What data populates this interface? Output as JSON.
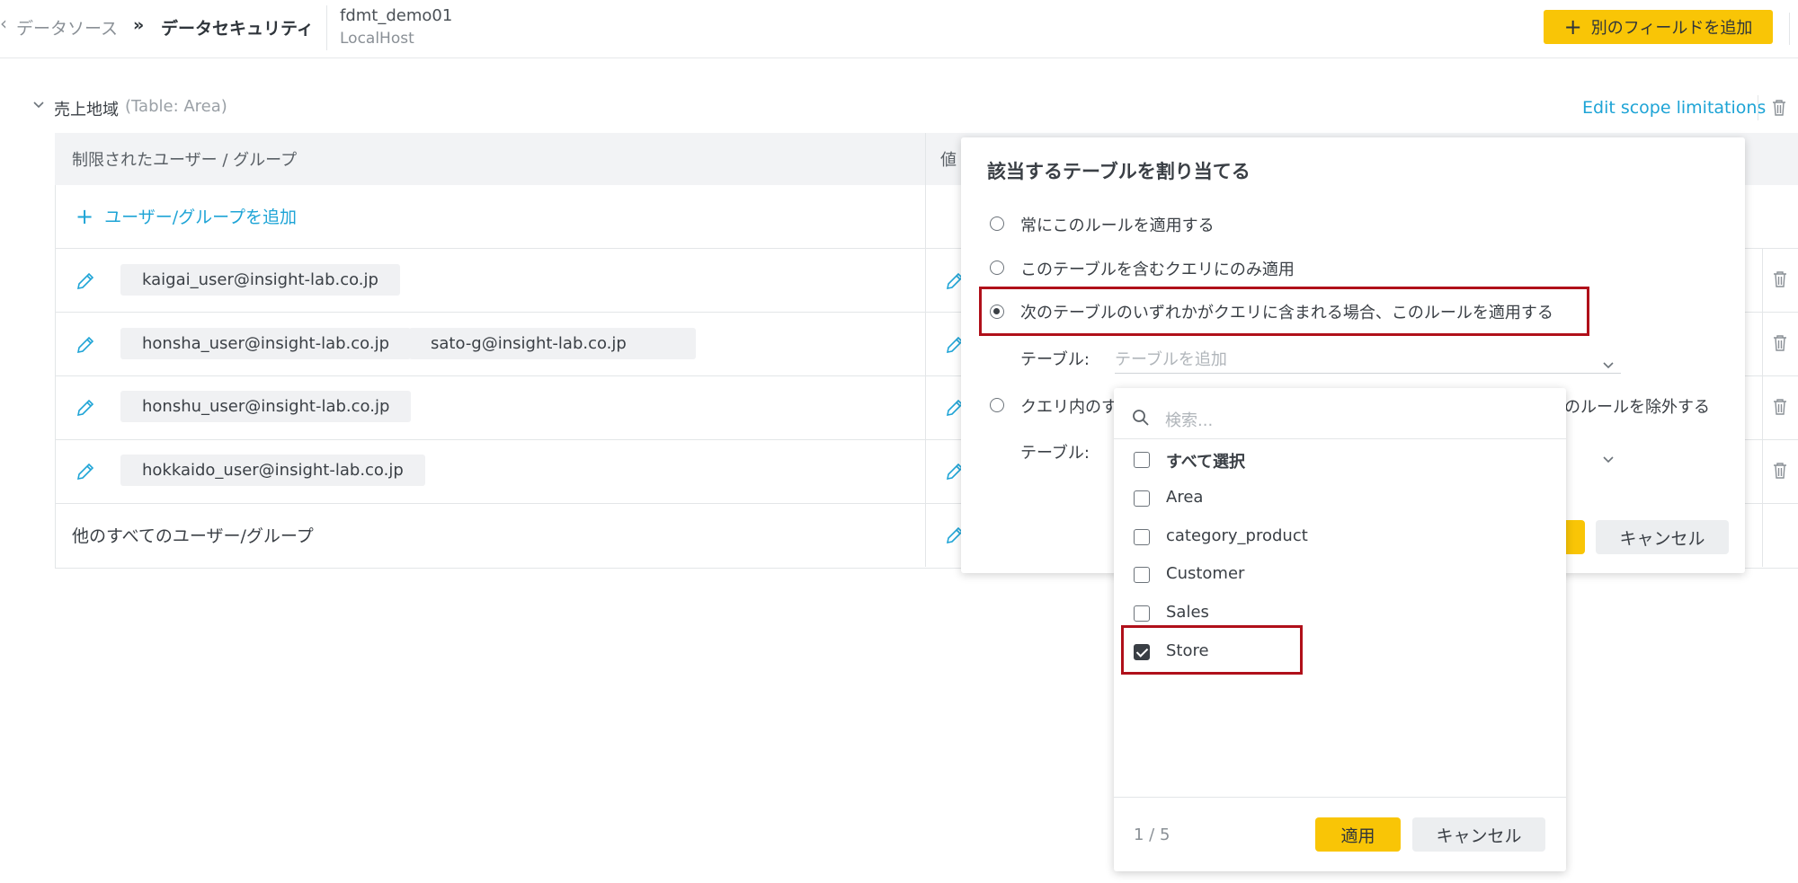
{
  "header": {
    "back_glyph": "‹",
    "breadcrumb_datasource": "データソース",
    "breadcrumb_sep": "»",
    "breadcrumb_current": "データセキュリティ",
    "connection_name": "fdmt_demo01",
    "connection_host": "LocalHost",
    "add_field_label": "別のフィールドを追加",
    "add_field_plus": "+"
  },
  "section": {
    "title": "売上地域",
    "table_note": "(Table: Area)",
    "edit_scope_link": "Edit scope limitations"
  },
  "table": {
    "col_users": "制限されたユーザー / グループ",
    "col_values": "値",
    "add_user_plus": "+",
    "add_user_label": "ユーザー/グループを追加",
    "rows": [
      {
        "users": [
          "kaigai_user@insight-lab.co.jp"
        ]
      },
      {
        "users": [
          "honsha_user@insight-lab.co.jp",
          "sato-g@insight-lab.co.jp"
        ]
      },
      {
        "users": [
          "honshu_user@insight-lab.co.jp"
        ]
      },
      {
        "users": [
          "hokkaido_user@insight-lab.co.jp"
        ]
      }
    ],
    "others_label": "他のすべてのユーザー/グループ"
  },
  "popover": {
    "title": "該当するテーブルを割り当てる",
    "options": [
      {
        "label": "常にこのルールを適用する",
        "selected": false
      },
      {
        "label": "このテーブルを含むクエリにのみ適用",
        "selected": false
      },
      {
        "label": "次のテーブルのいずれかがクエリに含まれる場合、このルールを適用する",
        "selected": true
      },
      {
        "label": "クエリ内のす",
        "label_tail": "のルールを除外する",
        "selected": false
      }
    ],
    "table_label": "テーブル:",
    "table_placeholder": "テーブルを追加",
    "cancel_label": "キャンセル",
    "highlight_color": "#b0101a"
  },
  "dropdown": {
    "search_placeholder": "検索...",
    "select_all": "すべて選択",
    "items": [
      {
        "label": "Area",
        "checked": false
      },
      {
        "label": "category_product",
        "checked": false
      },
      {
        "label": "Customer",
        "checked": false
      },
      {
        "label": "Sales",
        "checked": false
      },
      {
        "label": "Store",
        "checked": true
      }
    ],
    "count": "1 / 5",
    "apply_label": "適用",
    "cancel_label": "キャンセル"
  },
  "colors": {
    "accent_yellow": "#f9c506",
    "link_blue": "#1ea4d6",
    "highlight_red": "#b0101a"
  }
}
